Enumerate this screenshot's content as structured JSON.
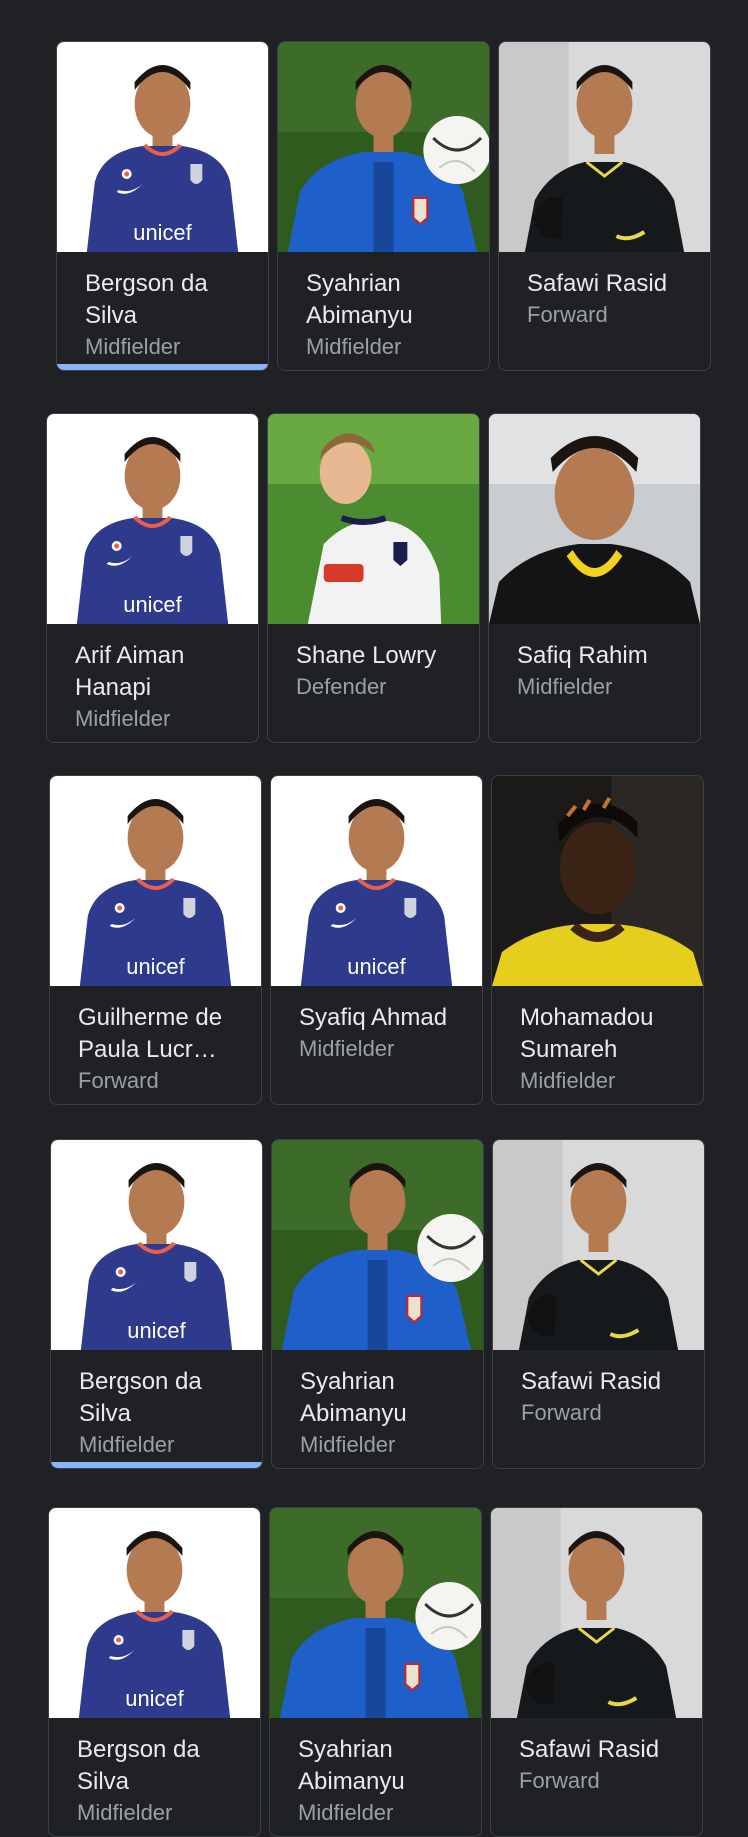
{
  "rows": [
    {
      "cards": [
        {
          "name": "Bergson da Silva",
          "role": "Midfielder",
          "photo": "jdt-blue-jersey-photo",
          "selected": true
        },
        {
          "name": "Syahrian Abimanyu",
          "role": "Midfielder",
          "photo": "newcastle-jersey-ball-photo",
          "selected": false
        },
        {
          "name": "Safawi Rasid",
          "role": "Forward",
          "photo": "black-tracksuit-photo",
          "selected": false
        }
      ]
    },
    {
      "cards": [
        {
          "name": "Arif Aiman Hanapi",
          "role": "Midfielder",
          "photo": "jdt-blue-jersey-photo",
          "selected": false
        },
        {
          "name": "Shane Lowry",
          "role": "Defender",
          "photo": "white-jersey-grass-photo",
          "selected": false
        },
        {
          "name": "Safiq Rahim",
          "role": "Midfielder",
          "photo": "black-yellow-jersey-photo",
          "selected": false
        }
      ]
    },
    {
      "cards": [
        {
          "name": "Guilherme de Paula Lucr…",
          "role": "Forward",
          "photo": "jdt-blue-jersey-photo",
          "selected": false
        },
        {
          "name": "Syafiq Ahmad",
          "role": "Midfielder",
          "photo": "jdt-blue-jersey-photo",
          "selected": false
        },
        {
          "name": "Mohamadou Sumareh",
          "role": "Midfielder",
          "photo": "yellow-jersey-photo",
          "selected": false
        }
      ]
    },
    {
      "cards": [
        {
          "name": "Bergson da Silva",
          "role": "Midfielder",
          "photo": "jdt-blue-jersey-photo",
          "selected": true
        },
        {
          "name": "Syahrian Abimanyu",
          "role": "Midfielder",
          "photo": "newcastle-jersey-ball-photo",
          "selected": false
        },
        {
          "name": "Safawi Rasid",
          "role": "Forward",
          "photo": "black-tracksuit-photo",
          "selected": false
        }
      ]
    },
    {
      "cards": [
        {
          "name": "Bergson da Silva",
          "role": "Midfielder",
          "photo": "jdt-blue-jersey-photo",
          "selected": false
        },
        {
          "name": "Syahrian Abimanyu",
          "role": "Midfielder",
          "photo": "newcastle-jersey-ball-photo",
          "selected": false
        },
        {
          "name": "Safawi Rasid",
          "role": "Forward",
          "photo": "black-tracksuit-photo",
          "selected": false
        }
      ]
    }
  ],
  "colors": {
    "background": "#202124",
    "card_border": "#3c4043",
    "name_text": "#e8eaed",
    "role_text": "#9aa0a6",
    "selected_accent": "#8ab4f8",
    "jdt_jersey": "#2e3a8c",
    "jdt_collar": "#e8604a",
    "newcastle_jersey": "#1f5fc9",
    "skin": "#b47a52"
  },
  "jersey_text": "unicef"
}
